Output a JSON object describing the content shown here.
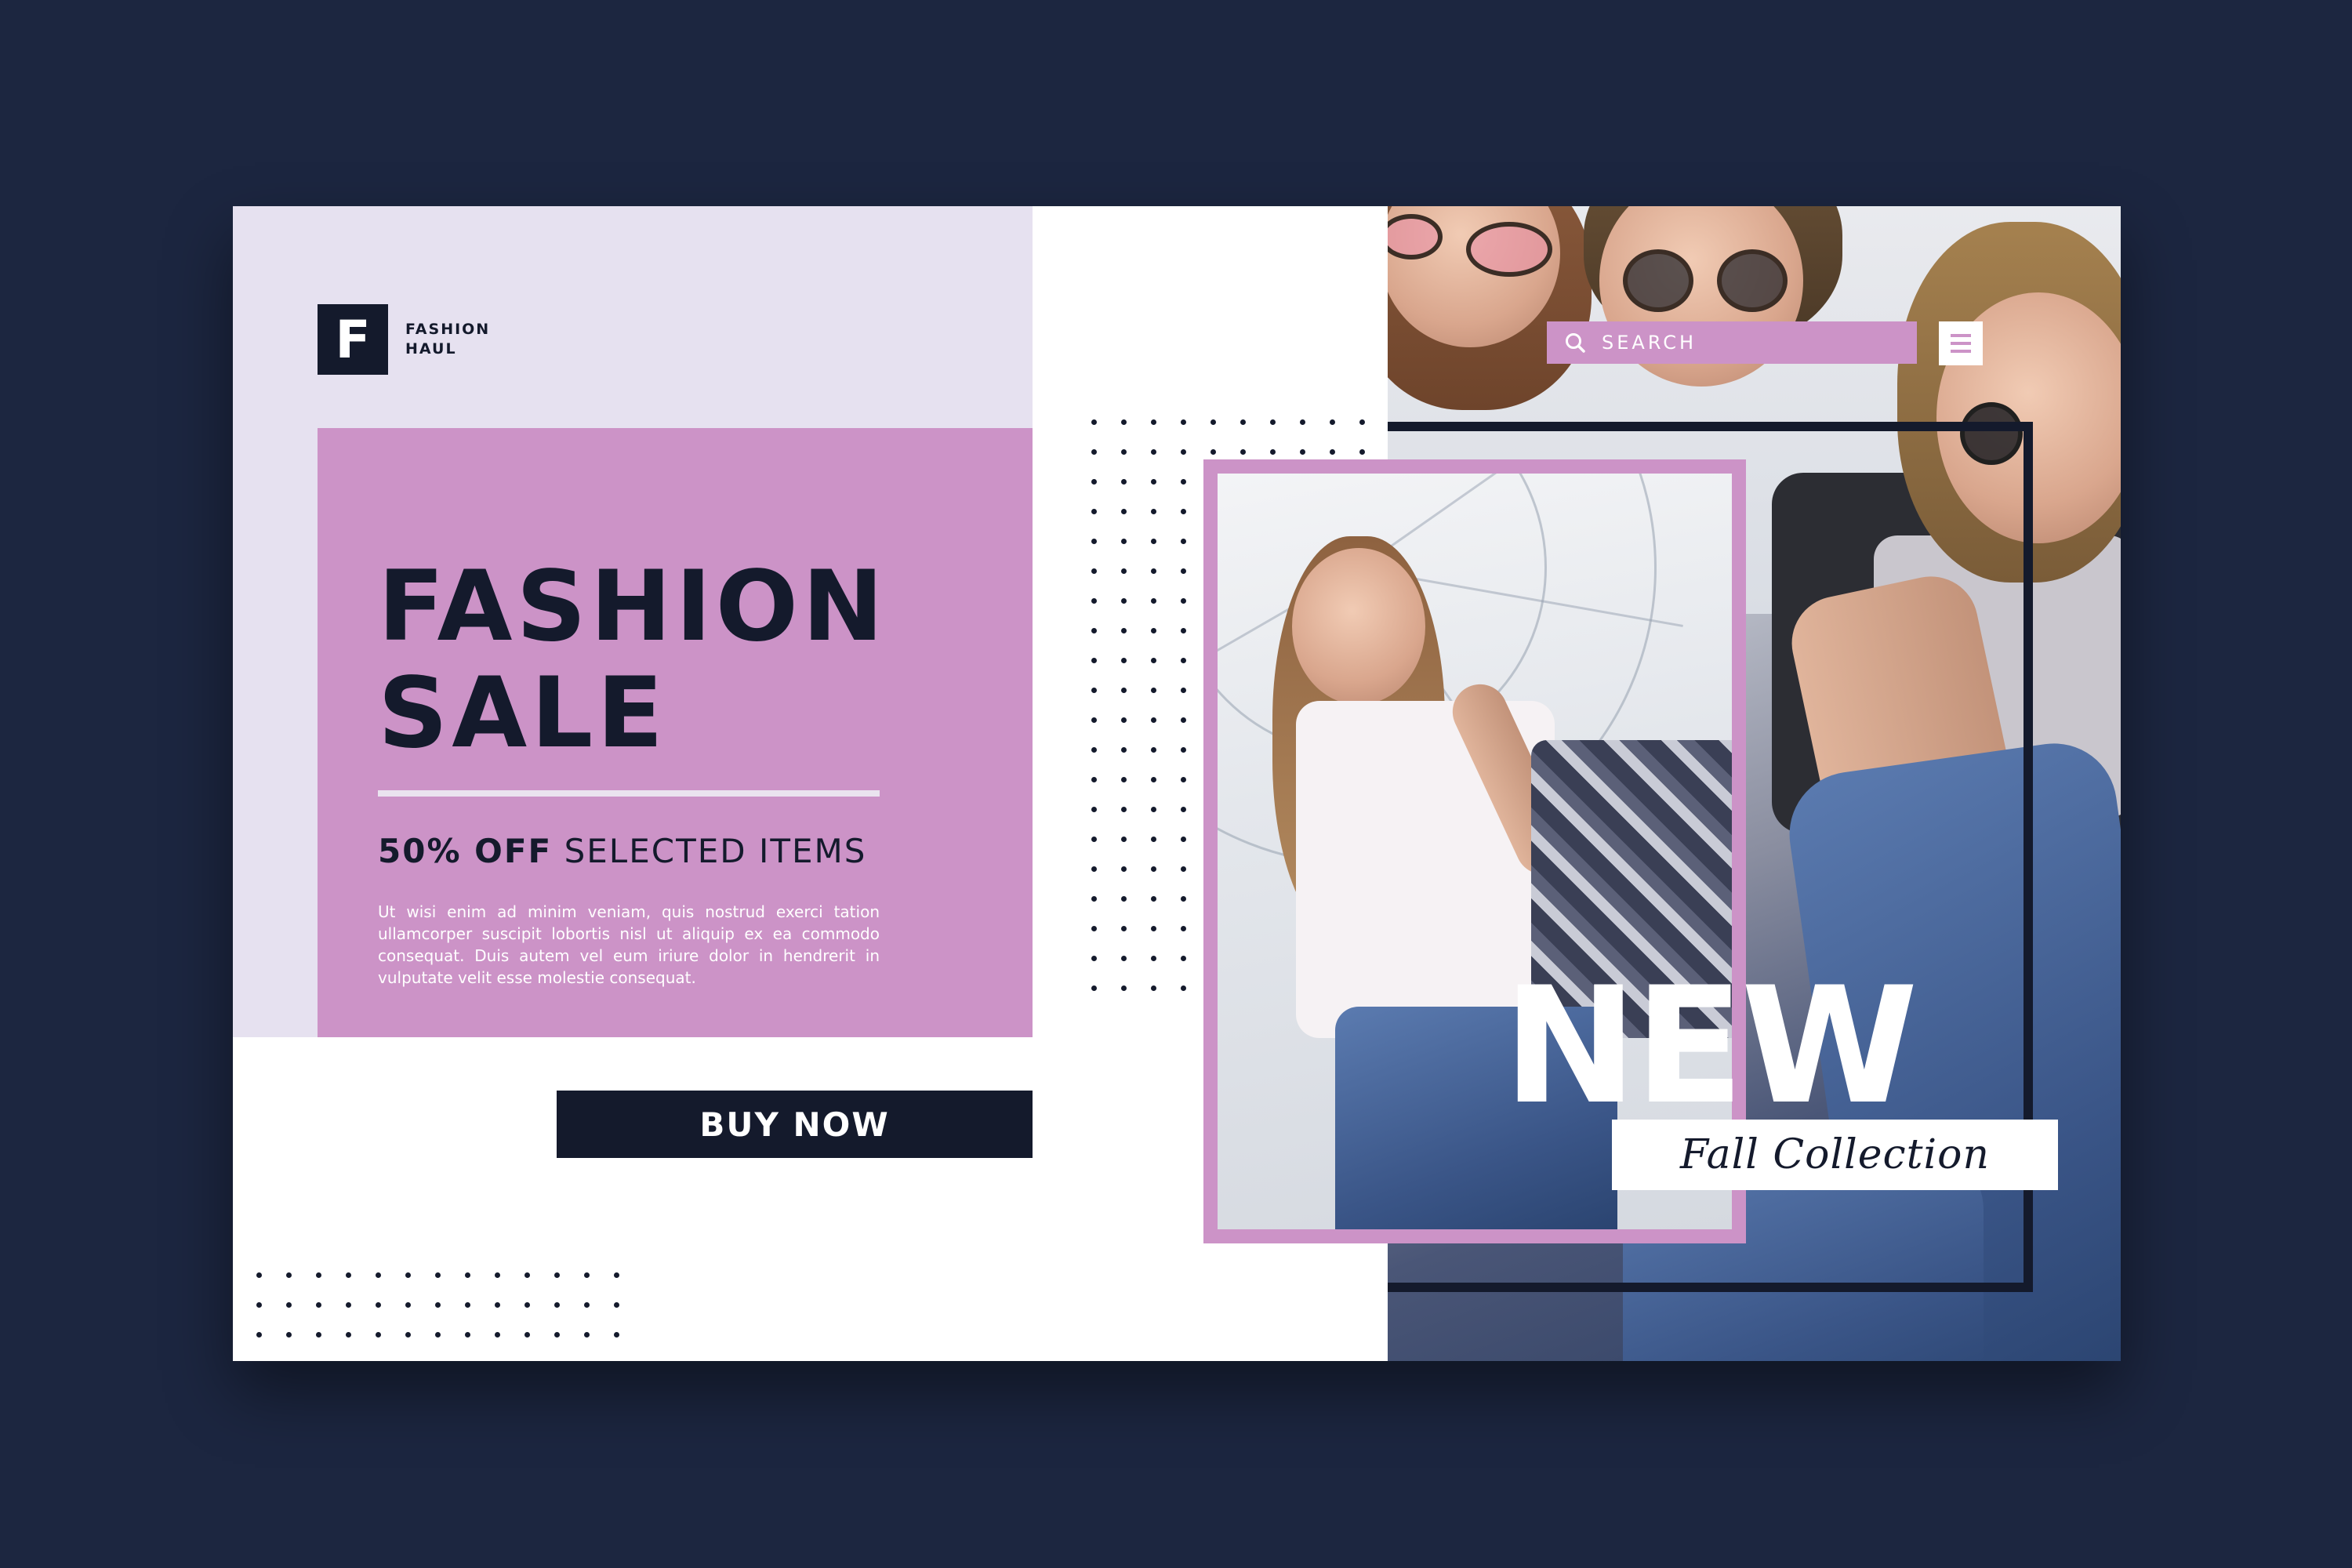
{
  "brand": {
    "logo_letter": "F",
    "name_line1": "FASHION",
    "name_line2": "HAUL"
  },
  "hero": {
    "title_line1": "FASHION",
    "title_line2": "SALE",
    "offer_bold": "50% OFF",
    "offer_rest": "SELECTED ITEMS",
    "description": "Ut wisi enim ad minim veniam, quis nostrud exerci tation ullamcorper suscipit lobortis nisl ut aliquip ex ea commodo consequat. Duis autem vel eum iriure dolor in hendrerit in vulputate velit esse molestie consequat.",
    "cta_label": "BUY NOW"
  },
  "search": {
    "placeholder": "SEARCH"
  },
  "feature": {
    "badge": "NEW",
    "subtitle": "Fall Collection"
  },
  "icons": {
    "search": "search-icon",
    "menu": "hamburger-menu-icon",
    "logo": "logo-icon"
  },
  "colors": {
    "background": "#1c2640",
    "accent": "#cc93c7",
    "lavender": "#e6e1f0",
    "navy": "#141a2c"
  }
}
